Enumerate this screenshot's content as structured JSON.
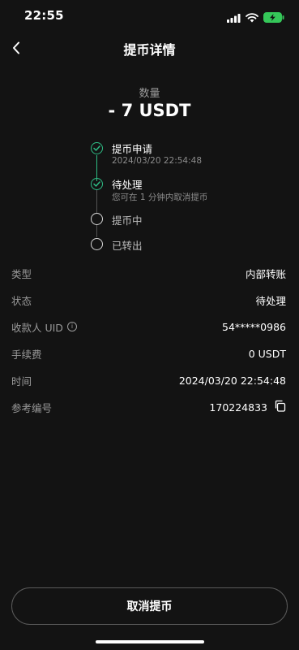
{
  "status_bar": {
    "time": "22:55"
  },
  "nav": {
    "title": "提币详情"
  },
  "amount": {
    "label": "数量",
    "value": "- 7 USDT"
  },
  "timeline": [
    {
      "title": "提币申请",
      "subtitle": "2024/03/20 22:54:48",
      "state": "done"
    },
    {
      "title": "待处理",
      "subtitle": "您可在 1 分钟内取消提币",
      "state": "done"
    },
    {
      "title": "提币中",
      "subtitle": "",
      "state": "pending"
    },
    {
      "title": "已转出",
      "subtitle": "",
      "state": "pending"
    }
  ],
  "details": [
    {
      "label": "类型",
      "value": "内部转账"
    },
    {
      "label": "状态",
      "value": "待处理"
    },
    {
      "label": "收款人 UID",
      "value": "54*****0986"
    },
    {
      "label": "手续费",
      "value": "0 USDT"
    },
    {
      "label": "时间",
      "value": "2024/03/20 22:54:48"
    },
    {
      "label": "参考编号",
      "value": "170224833"
    }
  ],
  "cancel_button": {
    "label": "取消提币"
  },
  "colors": {
    "background": "#131313",
    "accent_green": "#2ebd85",
    "muted": "#9a9a9a",
    "battery": "#35c759"
  }
}
